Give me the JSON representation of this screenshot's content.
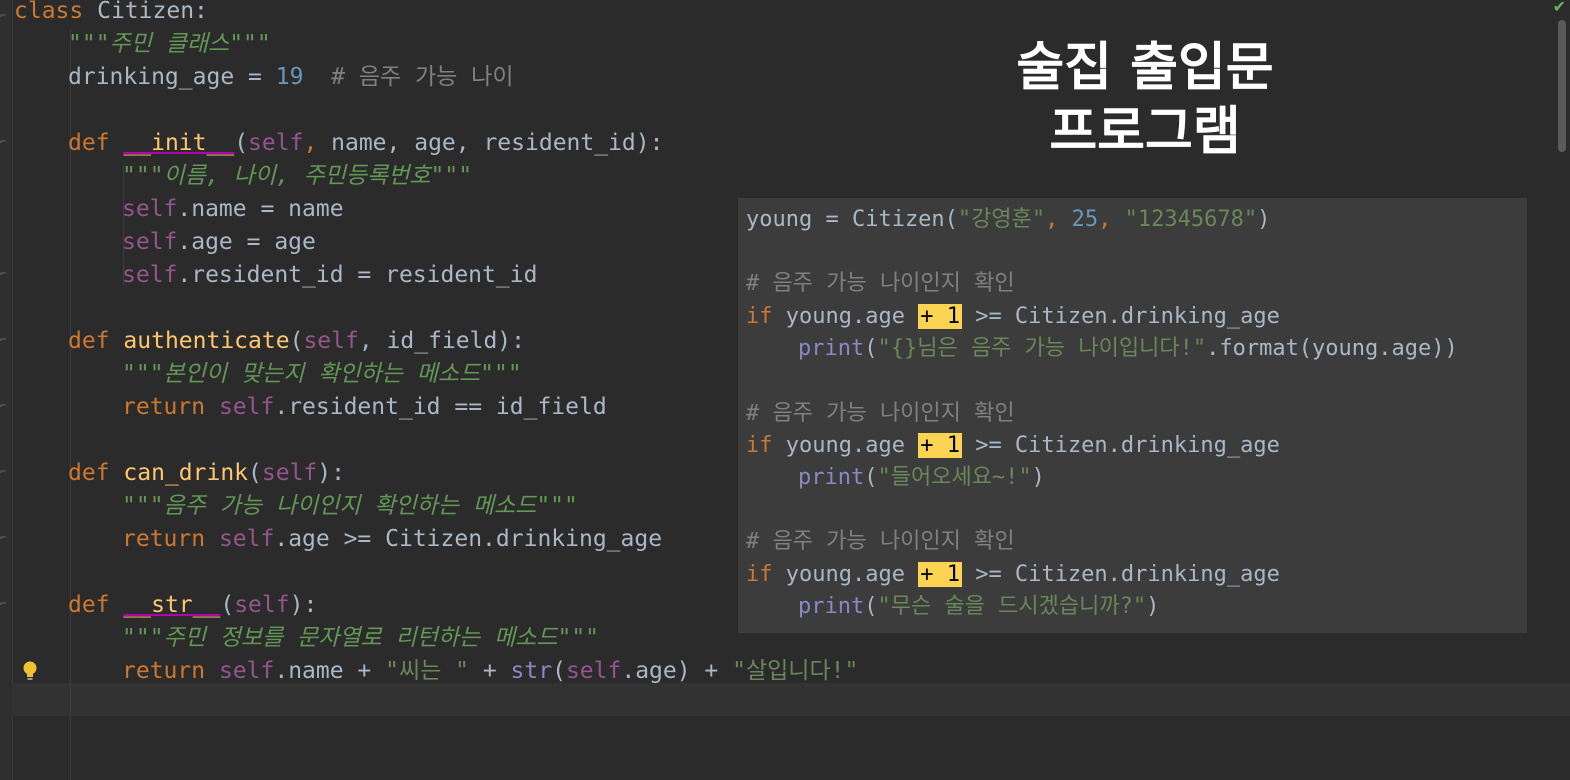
{
  "editor": {
    "lines": {
      "l1": {
        "kw": "class",
        "name": "Citizen:"
      },
      "l2": {
        "doc": "\"\"\"주민 클래스\"\"\""
      },
      "l3": {
        "name": "drinking_age = ",
        "num": "19",
        "cmt": "# 음주 가능 나이"
      },
      "l4": {
        "kw": "def",
        "fn": "__init__",
        "args_a": "(",
        "self": "self",
        "sep": ", ",
        "args_b": "name, age, resident_id):"
      },
      "l5": {
        "doc": "\"\"\"이름, 나이, 주민등록번호\"\"\""
      },
      "l6": {
        "self": "self",
        "rest": ".name = name"
      },
      "l7": {
        "self": "self",
        "rest": ".age = age"
      },
      "l8": {
        "self": "self",
        "rest": ".resident_id = resident_id"
      },
      "l9": {
        "kw": "def",
        "fn": "authenticate",
        "open": "(",
        "self": "self",
        "rest": ", id_field):"
      },
      "l10": {
        "doc": "\"\"\"본인이 맞는지 확인하는 메소드\"\"\""
      },
      "l11": {
        "kw": "return",
        "self": "self",
        "rest": ".resident_id == id_field"
      },
      "l12": {
        "kw": "def",
        "fn": "can_drink",
        "open": "(",
        "self": "self",
        "rest": "):"
      },
      "l13": {
        "doc": "\"\"\"음주 가능 나이인지 확인하는 메소드\"\"\""
      },
      "l14": {
        "kw": "return",
        "self": "self",
        "rest": ".age >= Citizen.drinking_age"
      },
      "l15": {
        "kw": "def",
        "fn": "__str__",
        "open": "(",
        "self": "self",
        "rest": "):"
      },
      "l16": {
        "doc": "\"\"\"주민 정보를 문자열로 리턴하는 메소드\"\"\""
      },
      "l17": {
        "kw": "return",
        "self": "self",
        "rest_a": ".name + ",
        "str_a": "\"씨는 \"",
        "rest_b": " + ",
        "builtin": "str",
        "rest_c": "(",
        "self2": "self",
        "rest_d": ".age) + ",
        "str_b": "\"살입니다!\""
      }
    }
  },
  "overlay": {
    "title_line1": "술집 출입문",
    "title_line2": "프로그램",
    "code": {
      "o1": {
        "a": "young = Citizen(",
        "s1": "\"강영훈\"",
        "c": ", ",
        "n": "25",
        "d": ", ",
        "s2": "\"12345678\"",
        "e": ")"
      },
      "o2": {
        "cmt": "# 음주 가능 나이인지 확인"
      },
      "o3": {
        "kw": "if",
        "a": " young.age ",
        "hl": "+ 1",
        "b": " >= Citizen.drinking_age"
      },
      "o4": {
        "fn": "print",
        "a": "(",
        "s": "\"{}님은 음주 가능 나이입니다!\"",
        "b": ".format(young.age))"
      },
      "o5": {
        "cmt": "# 음주 가능 나이인지 확인"
      },
      "o6": {
        "kw": "if",
        "a": " young.age ",
        "hl": "+ 1",
        "b": " >= Citizen.drinking_age"
      },
      "o7": {
        "fn": "print",
        "a": "(",
        "s": "\"들어오세요~!\"",
        "b": ")"
      },
      "o8": {
        "cmt": "# 음주 가능 나이인지 확인"
      },
      "o9": {
        "kw": "if",
        "a": " young.age ",
        "hl": "+ 1",
        "b": " >= Citizen.drinking_age"
      },
      "o10": {
        "fn": "print",
        "a": "(",
        "s": "\"무슨 술을 드시겠습니까?\"",
        "b": ")"
      }
    }
  },
  "icons": {
    "bulb": "lightbulb-icon",
    "check": "check-icon",
    "fold": "fold-marker-icon"
  },
  "colors": {
    "background": "#2b2b2b",
    "keyword": "#cc7832",
    "self": "#94558d",
    "number": "#6897bb",
    "string": "#6a8759",
    "docstring": "#629755",
    "comment": "#808080",
    "function": "#ffc66d",
    "highlight": "#fcd453"
  }
}
